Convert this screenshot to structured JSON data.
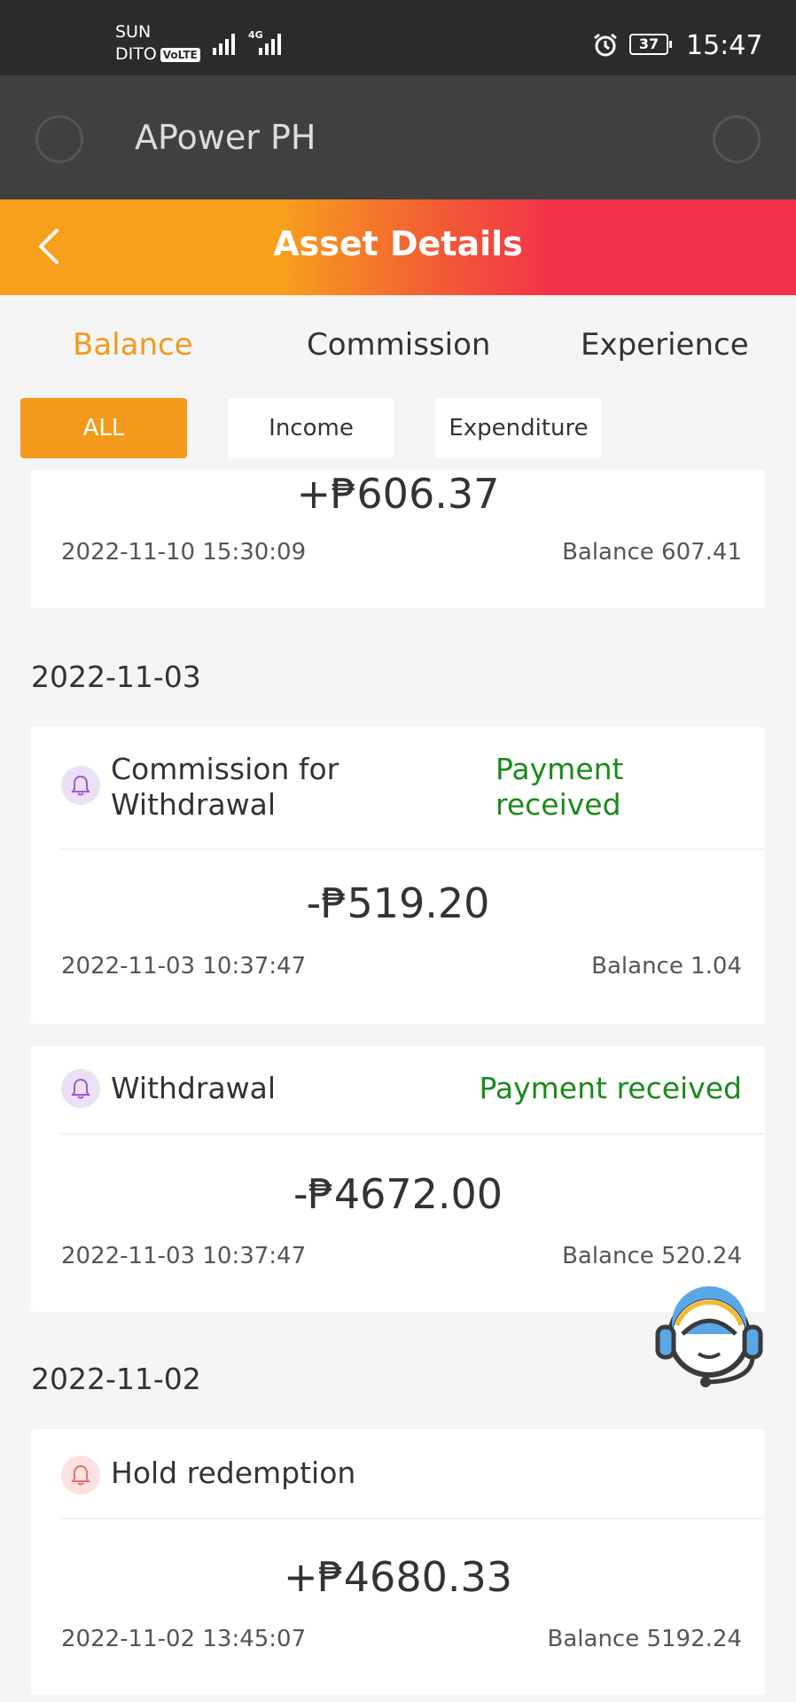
{
  "status_bar": {
    "carrier_1": "SUN",
    "carrier_2": "DITO",
    "volte": "VoLTE",
    "network": "4G",
    "battery": "37",
    "time": "15:47"
  },
  "app": {
    "title": "APower PH"
  },
  "header": {
    "title": "Asset Details"
  },
  "tabs": [
    {
      "label": "Balance",
      "active": true
    },
    {
      "label": "Commission",
      "active": false
    },
    {
      "label": "Experience",
      "active": false
    }
  ],
  "filters": [
    {
      "label": "ALL",
      "active": true
    },
    {
      "label": "Income",
      "active": false
    },
    {
      "label": "Expenditure",
      "active": false
    }
  ],
  "records": [
    {
      "amount": "+₱606.37",
      "time": "2022-11-10 15:30:09",
      "balance": "Balance 607.41"
    },
    {
      "title": "Commission for Withdrawal",
      "status": "Payment received",
      "amount": "-₱519.20",
      "time": "2022-11-03 10:37:47",
      "balance": "Balance 1.04"
    },
    {
      "title": "Withdrawal",
      "status": "Payment received",
      "amount": "-₱4672.00",
      "time": "2022-11-03 10:37:47",
      "balance": "Balance 520.24"
    },
    {
      "title": "Hold redemption",
      "amount": "+₱4680.33",
      "time": "2022-11-02 13:45:07",
      "balance": "Balance 5192.24"
    }
  ],
  "dates": [
    "2022-11-03",
    "2022-11-02"
  ],
  "colors": {
    "accent": "#f39a1c",
    "header_gradient_end": "#f3304a",
    "status_green": "#1a8a1a"
  },
  "icons": {
    "back": "chevron-left-icon",
    "bell": "bell-icon",
    "support": "customer-service-icon"
  }
}
